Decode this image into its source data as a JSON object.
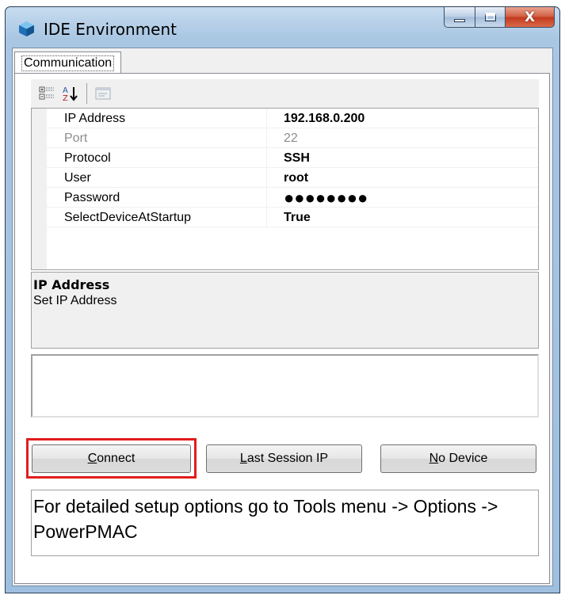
{
  "window": {
    "title": "IDE Environment",
    "close_glyph": "X"
  },
  "tabs": [
    {
      "label": "Communication"
    }
  ],
  "toolbar": {
    "buttons": [
      "categorized-icon",
      "alphabetical-sort-icon",
      "property-pages-icon"
    ]
  },
  "properties": [
    {
      "name": "IP Address",
      "value": "192.168.0.200"
    },
    {
      "name": "Port",
      "value": "22"
    },
    {
      "name": "Protocol",
      "value": "SSH"
    },
    {
      "name": "User",
      "value": "root"
    },
    {
      "name": "Password",
      "value": "●●●●●●●●"
    },
    {
      "name": "SelectDeviceAtStartup",
      "value": "True"
    }
  ],
  "help": {
    "title": "IP Address",
    "description": "Set IP Address"
  },
  "output": {
    "text": ""
  },
  "buttons": {
    "connect": {
      "mnemonic": "C",
      "rest": "onnect"
    },
    "last_session": {
      "mnemonic": "L",
      "rest": "ast Session IP"
    },
    "no_device": {
      "mnemonic": "N",
      "rest": "o Device"
    }
  },
  "footer": {
    "text": "For detailed setup options go to Tools menu -> Options -> PowerPMAC"
  },
  "colors": {
    "highlight": "#e01e1e",
    "titlebar": "#b7d0ea",
    "close_button": "#c7442a"
  }
}
